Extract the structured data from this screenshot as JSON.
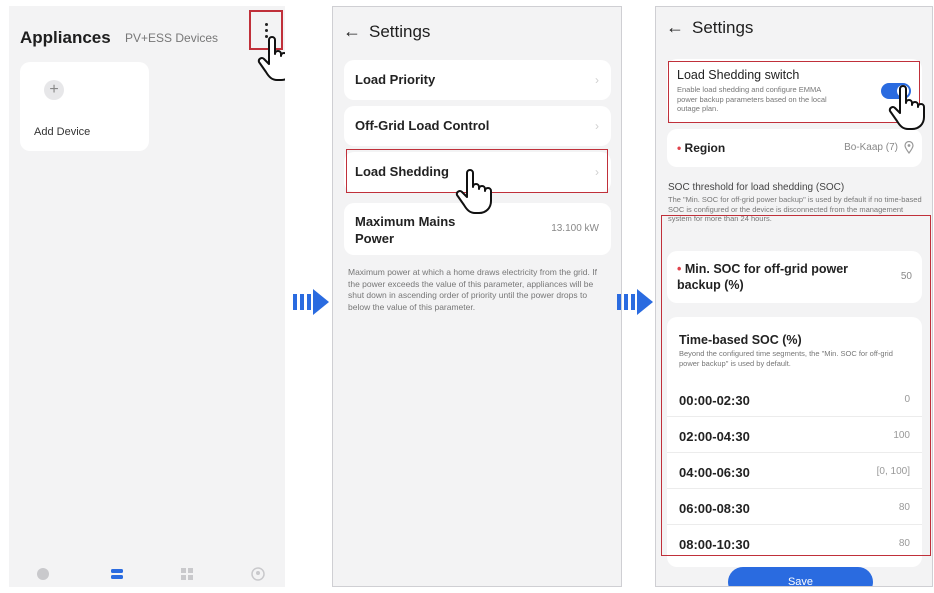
{
  "panel1": {
    "title": "Appliances",
    "subtitle": "PV+ESS Devices",
    "add_device_label": "Add Device",
    "nav_icons": [
      "home-icon",
      "devices-icon",
      "apps-icon",
      "profile-icon"
    ]
  },
  "panel2": {
    "header": "Settings",
    "items": [
      "Load Priority",
      "Off-Grid Load Control",
      "Load Shedding"
    ],
    "max_power_label": "Maximum Mains Power",
    "max_power_value": "13.100 kW",
    "max_power_desc": "Maximum power at which a home draws electricity from the grid. If the power exceeds the value of this parameter, appliances will be shut down in ascending order of priority until the power drops to below the value of this parameter."
  },
  "panel3": {
    "header": "Settings",
    "switch_label": "Load Shedding switch",
    "switch_desc": "Enable load shedding and configure EMMA power backup parameters based on the local outage plan.",
    "switch_on": true,
    "region_label": "Region",
    "region_value": "Bo-Kaap (7)",
    "soc_title": "SOC threshold for load shedding (SOC)",
    "soc_desc": "The \"Min. SOC for off-grid power backup\" is used by default if no time-based SOC is configured or the device is disconnected from the management system for more than 24 hours.",
    "min_soc_label": "Min. SOC for off-grid power backup (%)",
    "min_soc_value": "50",
    "time_soc_title": "Time-based SOC (%)",
    "time_soc_desc": "Beyond the configured time segments, the \"Min. SOC for off-grid power backup\" is used by default.",
    "time_rows": [
      {
        "time": "00:00-02:30",
        "value": "0"
      },
      {
        "time": "02:00-04:30",
        "value": "100"
      },
      {
        "time": "04:00-06:30",
        "value": "[0, 100]"
      },
      {
        "time": "06:00-08:30",
        "value": "80"
      },
      {
        "time": "08:00-10:30",
        "value": "80"
      }
    ],
    "save_label": "Save"
  },
  "colors": {
    "accent": "#2a6be0",
    "highlight_box": "#c0303a",
    "required": "#e0434c"
  }
}
